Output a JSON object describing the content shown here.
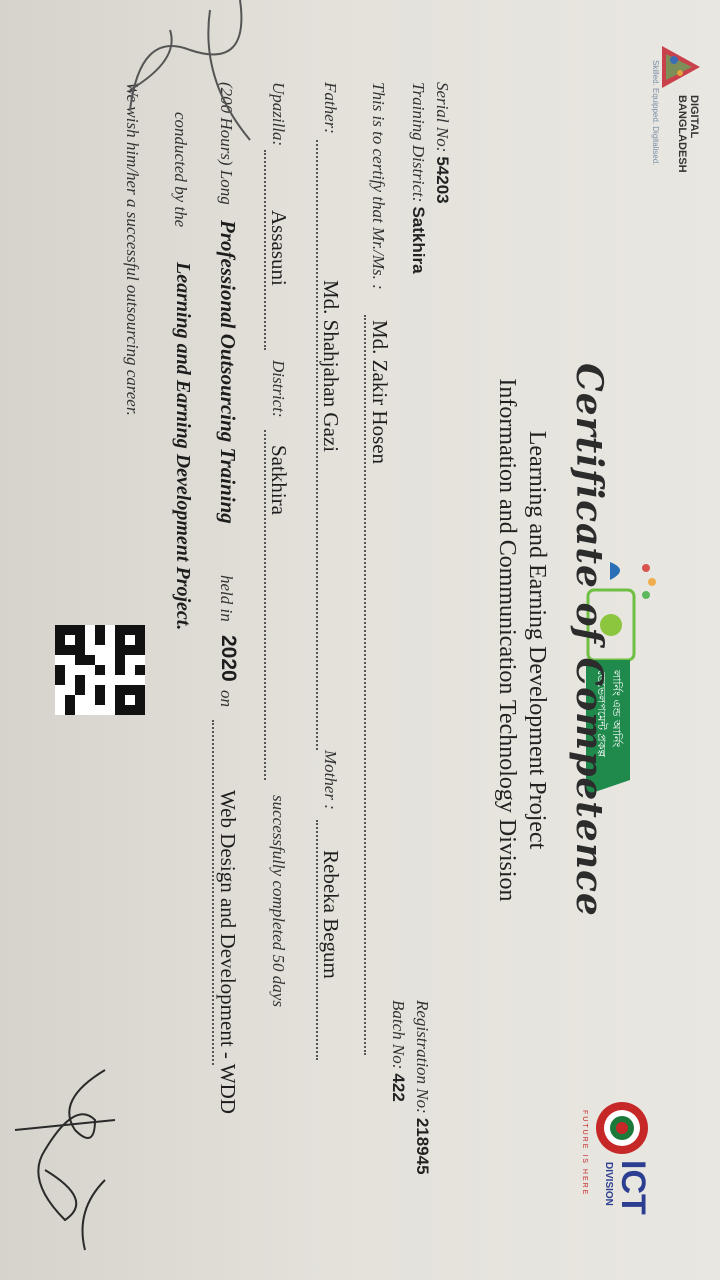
{
  "header": {
    "digital_bangladesh_line1": "DIGITAL",
    "digital_bangladesh_line2": "BANGLADESH",
    "digital_bangladesh_tag": "Skilled. Equipped. Digitalised.",
    "lead_logo_text_line1": "লার্নিং এন্ড আর্নিং",
    "lead_logo_text_line2": "ডেভেলপমেন্ট প্রকল্প",
    "ict_logo_main": "ICT",
    "ict_logo_sub": "DIVISION",
    "ict_logo_tag": "FUTURE IS HERE"
  },
  "certificate": {
    "title": "Certificate of Competence",
    "subtitle_line1": "Learning and Earning Development Project",
    "subtitle_line2": "Information and Communication Technology Division",
    "serial_label": "Serial No:",
    "serial_value": "54203",
    "district_label": "Training District:",
    "district_value": "Satkhira",
    "registration_label": "Registration No:",
    "registration_value": "218945",
    "batch_label": "Batch No:",
    "batch_value": "422",
    "certify_label": "This is to certify that Mr./Ms. :",
    "name_value": "Md. Zakir Hosen",
    "father_label": "Father:",
    "father_value": "Md. Shahjahan Gazi",
    "mother_label": "Mother :",
    "mother_value": "Rebeka Begum",
    "upazilla_label": "Upazilla:",
    "upazilla_value": "Assasuni",
    "district2_label": "District:",
    "district2_value": "Satkhira",
    "completed_text": "successfully completed 50 days",
    "hours_text": "(200 Hours) Long",
    "training_name": "Professional Outsourcing Training",
    "held_text": "held in",
    "year": "2020",
    "on_text": "on",
    "course_value": "Web Design and Development - WDD",
    "conducted_text": "conducted by the",
    "project_name": "Learning and Earning Development Project.",
    "wish_text": "We wish him/her a successful outsourcing career."
  },
  "colors": {
    "paper": "#e6e4de",
    "ict_red": "#c62828",
    "ict_green": "#1b7a3a",
    "lead_green": "#1f8a4c"
  }
}
